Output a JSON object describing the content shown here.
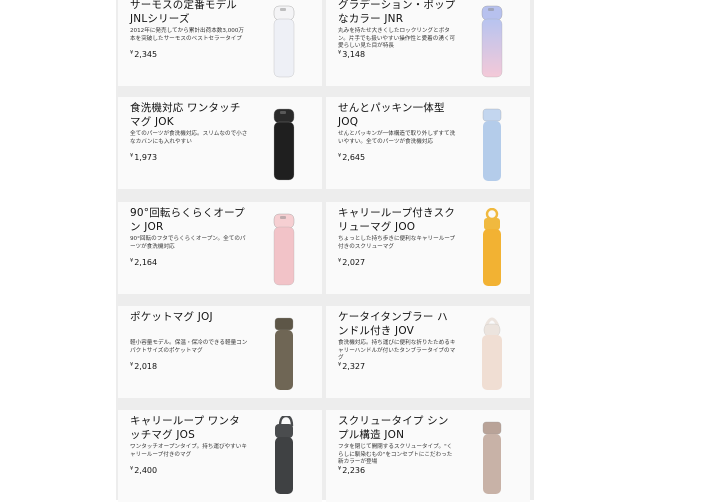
{
  "products": [
    {
      "title": "サーモスの定番モデル JNLシリーズ",
      "desc": "2012年に発売してから累計出荷本数3,000万本を突破したサーモスのベストセラータイプ",
      "currency": "¥",
      "price": "2,345",
      "color": "#eef0f6",
      "cap": "#f4f4f6",
      "style": "flip"
    },
    {
      "title": "グラデーション・ポップなカラー JNR",
      "desc": "丸みを持たせ大きくしたロックリングとボタン。片手でも扱いやすい操作性と愛着の湧く可愛らしい見た目が特長",
      "currency": "¥",
      "price": "3,148",
      "color": "#c6c8ef",
      "cap": "#b7c1ee",
      "style": "flip-gradient"
    },
    {
      "title": "食洗機対応 ワンタッチマグ JOK",
      "desc": "全てのパーツが食洗機対応。スリムなので小さなカバンにも入れやすい",
      "currency": "¥",
      "price": "1,973",
      "color": "#1f1f1f",
      "cap": "#2a2a2a",
      "style": "flip"
    },
    {
      "title": "せんとパッキン一体型 JOQ",
      "desc": "せんとパッキンが一体構造で取り外しずすて洗いやすい。全てのパーツが食洗機対応",
      "currency": "¥",
      "price": "2,645",
      "color": "#b4ccea",
      "cap": "#c3d6ef",
      "style": "screw"
    },
    {
      "title": "90°回転らくらくオープン JOR",
      "desc": "90°回転のフタでらくらくオープン。全てのパーツが食洗機対応",
      "currency": "¥",
      "price": "2,164",
      "color": "#f2c3c8",
      "cap": "#f6cfd2",
      "style": "flip"
    },
    {
      "title": "キャリーループ付きスクリューマグ JOO",
      "desc": "ちょっとした持ち歩きに便利なキャリーループ付きのスクリューマグ",
      "currency": "¥",
      "price": "2,027",
      "color": "#f2b233",
      "cap": "#f0b93f",
      "style": "loop-ring"
    },
    {
      "title": "ポケットマグ JOJ",
      "desc": "軽小容量モデル。保温・保冷のできる軽量コンパクトサイズのポケットマグ",
      "currency": "¥",
      "price": "2,018",
      "color": "#6f6655",
      "cap": "#5d5647",
      "style": "screw"
    },
    {
      "title": "ケータイタンブラー ハンドル付き JOV",
      "desc": "食洗機対応。持ち運びに便利な折りたためるキャリーハンドルが付いたタンブラータイプのマグ",
      "currency": "¥",
      "price": "2,327",
      "color": "#f0ded3",
      "cap": "#ece4de",
      "style": "handle"
    },
    {
      "title": "キャリーループ ワンタッチマグ JOS",
      "desc": "ワンタッチオープンタイプ。持ち運びやすいキャリーループ付きのマグ",
      "currency": "¥",
      "price": "2,400",
      "color": "#3f4143",
      "cap": "#4a4c4e",
      "style": "loop"
    },
    {
      "title": "スクリュータイプ シンプル構造 JON",
      "desc": "フタを閉じて開閉するスクリュータイプ。\"くらしに馴染むもの\"をコンセプトにこだわった新カラーが登場",
      "currency": "¥",
      "price": "2,236",
      "color": "#c8b2a7",
      "cap": "#b9a398",
      "style": "screw"
    }
  ]
}
